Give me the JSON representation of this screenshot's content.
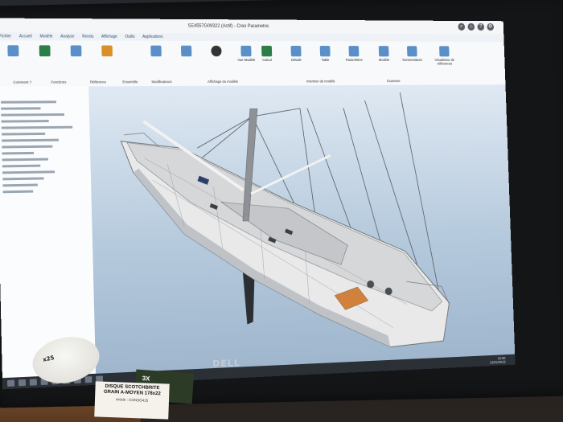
{
  "window": {
    "title": "SE4557G09322 (Actif) - Creo Parametric"
  },
  "menu": [
    "Fichier",
    "Accueil",
    "Modèle",
    "Analyse",
    "Rendu",
    "Affichage",
    "Outils",
    "Applications"
  ],
  "ribbon": {
    "items": [
      "Vue Modèle",
      "Calcul",
      "Détails",
      "Table",
      "Modèle",
      "Nomenclature",
      "Visualiseur de références",
      "Paramètres"
    ],
    "sections": [
      "Comment ?",
      "Fonctions",
      "Référence",
      "Ensemble",
      "Modificateurs",
      "Affichage du modèle",
      "Intention de modèle",
      "Examiner"
    ]
  },
  "viewport": {
    "object": "3D sailboat model"
  },
  "taskbar": {
    "time": "22:00",
    "date": "22/01/2013"
  },
  "monitor": {
    "brand": "DELL"
  },
  "desk": {
    "tape_text": "x25",
    "box_text": "3X",
    "label": {
      "line1": "DISQUE SCOTCHBRITE",
      "line2": "GRAIN A-MOYEN 178x22",
      "line3": "Article : CONSO415"
    }
  },
  "colors": {
    "hull": "#e9e9e9",
    "deck": "#cfcfcf",
    "wood": "#d0823c",
    "sky_top": "#dfe9f3",
    "sky_bottom": "#9fb6cd"
  }
}
